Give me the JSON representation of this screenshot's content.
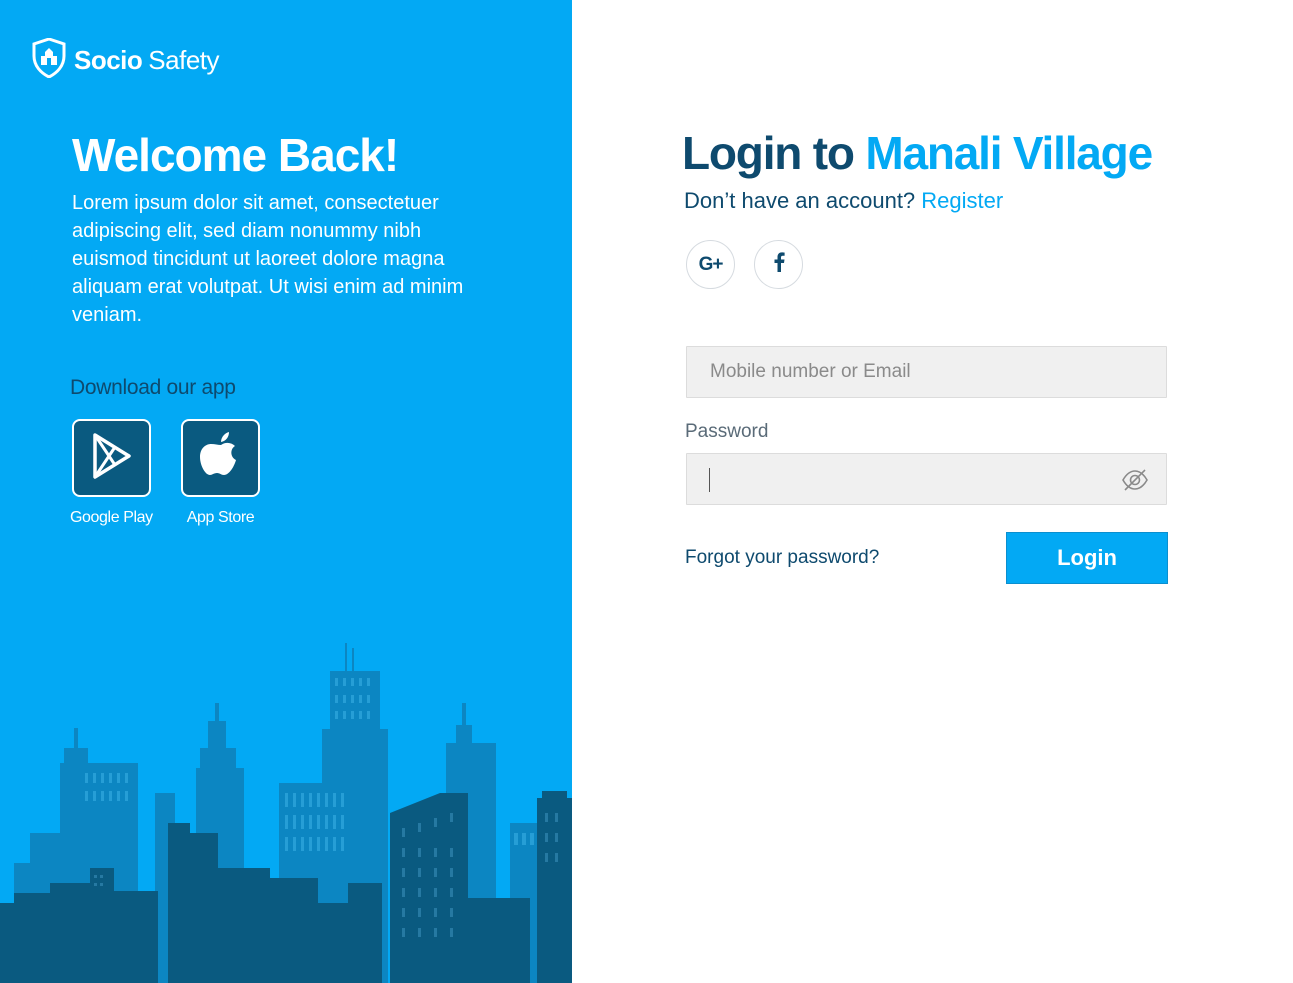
{
  "brand": {
    "name_bold": "Socio",
    "name_light": "Safety",
    "icon": "shield-icon"
  },
  "welcome": {
    "title": "Welcome Back!",
    "text": "Lorem ipsum dolor sit amet, consectetuer adipiscing elit, sed diam nonummy nibh euismod tincidunt ut laoreet dolore magna aliquam erat volutpat. Ut wisi enim ad minim veniam."
  },
  "download": {
    "title": "Download our app",
    "stores": [
      {
        "label": "Google Play",
        "icon": "google-play-icon"
      },
      {
        "label": "App Store",
        "icon": "apple-icon"
      }
    ]
  },
  "login": {
    "title_prefix": "Login to",
    "title_accent": "Manali Village",
    "no_account_text": "Don’t have an account?",
    "register_link": "Register",
    "social": [
      {
        "label": "G+",
        "icon": "google-plus-icon"
      },
      {
        "label": "f",
        "icon": "facebook-icon"
      }
    ],
    "email_placeholder": "Mobile number or Email",
    "email_value": "",
    "password_label": "Password",
    "password_value": "",
    "forgot_link": "Forgot your password?",
    "submit_label": "Login"
  },
  "colors": {
    "accent": "#03a9f4",
    "dark_text": "#0e4a6e",
    "store_tile": "#0a5a80",
    "field_bg": "#f0f0f0"
  }
}
